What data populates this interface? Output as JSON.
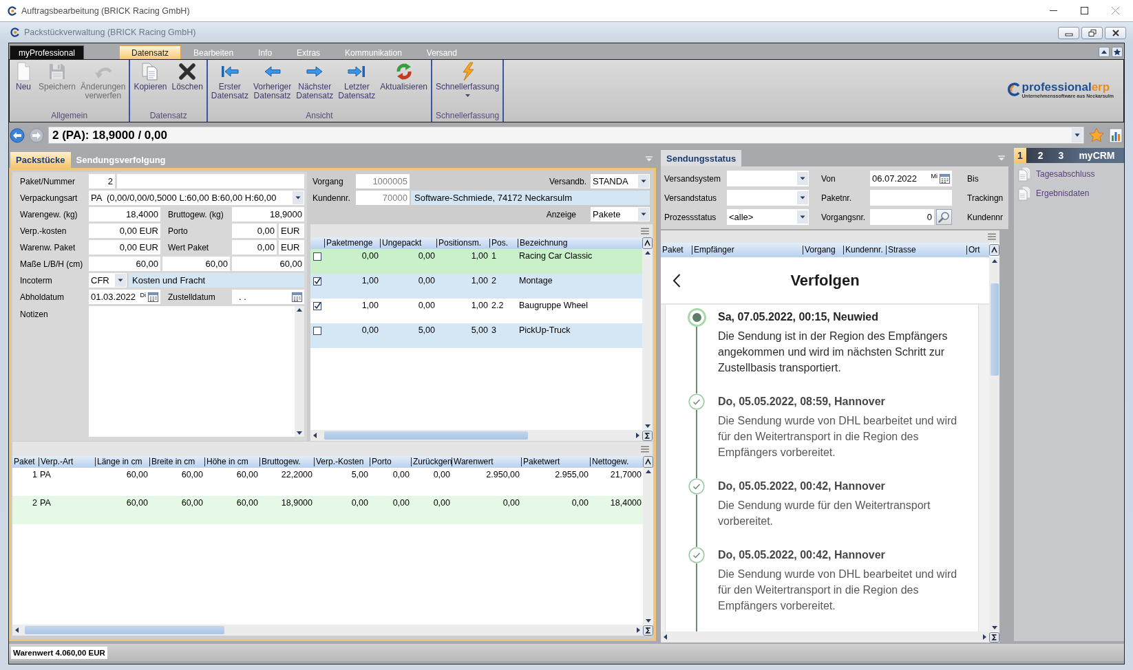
{
  "window": {
    "title": "Auftragsbearbeitung (BRICK Racing GmbH)"
  },
  "child_window": {
    "title": "Packstückverwaltung (BRICK Racing GmbH)"
  },
  "ribbon": {
    "app_tab": "myProfessional",
    "tabs": [
      {
        "label": "Datensatz",
        "selected": true
      },
      {
        "label": "Bearbeiten",
        "selected": false
      },
      {
        "label": "Info",
        "selected": false
      },
      {
        "label": "Extras",
        "selected": false
      },
      {
        "label": "Kommunikation",
        "selected": false
      },
      {
        "label": "Versand",
        "selected": false
      }
    ],
    "groups": [
      {
        "label": "Allgemein",
        "buttons": [
          {
            "label": "Neu",
            "disabled": false,
            "dropdown": false
          },
          {
            "label": "Speichern",
            "disabled": true,
            "dropdown": false
          },
          {
            "label": "Änderungen verwerfen",
            "disabled": true,
            "dropdown": false
          }
        ]
      },
      {
        "label": "Datensatz",
        "buttons": [
          {
            "label": "Kopieren",
            "disabled": false,
            "dropdown": false
          },
          {
            "label": "Löschen",
            "disabled": false,
            "dropdown": false
          }
        ]
      },
      {
        "label": "Ansicht",
        "buttons": [
          {
            "label": "Erster Datensatz",
            "disabled": false,
            "dropdown": false
          },
          {
            "label": "Vorheriger Datensatz",
            "disabled": false,
            "dropdown": false
          },
          {
            "label": "Nächster Datensatz",
            "disabled": false,
            "dropdown": false
          },
          {
            "label": "Letzter Datensatz",
            "disabled": false,
            "dropdown": false
          },
          {
            "label": "Aktualisieren",
            "disabled": false,
            "dropdown": false
          }
        ]
      },
      {
        "label": "Schnellerfassung",
        "buttons": [
          {
            "label": "Schnellerfassung",
            "disabled": false,
            "dropdown": true
          }
        ]
      }
    ]
  },
  "logo": {
    "text": "professional",
    "accent": "erp",
    "tagline": "Unternehmenssoftware aus Neckarsulm"
  },
  "record_bar": {
    "value": "2 (PA): 18,9000 / 0,00",
    "back_disabled": false,
    "forward_disabled": true
  },
  "main_tabs": [
    {
      "label": "Packstücke",
      "selected": true
    },
    {
      "label": "Sendungsverfolgung",
      "selected": false
    }
  ],
  "package_form": {
    "paket_nummer": {
      "label": "Paket/Nummer",
      "value": "2"
    },
    "verpackungsart": {
      "label": "Verpackungsart",
      "value": "PA  (0,00/0,00/0,5000 L:60,00 B:60,00 H:60,00"
    },
    "warengewicht": {
      "label": "Warengew. (kg)",
      "value": "18,4000"
    },
    "bruttogewicht": {
      "label": "Bruttogew. (kg)",
      "value": "18,9000"
    },
    "verp_kosten": {
      "label": "Verp.-kosten",
      "value": "0,00 EUR"
    },
    "porto": {
      "label": "Porto",
      "value": "0,00",
      "unit": "EUR"
    },
    "warenwert_paket": {
      "label": "Warenw. Paket",
      "value": "0,00 EUR"
    },
    "wert_paket": {
      "label": "Wert Paket",
      "value": "0,00",
      "unit": "EUR"
    },
    "masse": {
      "label": "Maße L/B/H (cm)",
      "values": [
        "60,00",
        "60,00",
        "60,00"
      ]
    },
    "incoterm": {
      "label": "Incoterm",
      "value": "CFR",
      "description": "Kosten und Fracht"
    },
    "abholdatum": {
      "label": "Abholdatum",
      "value": "01.03.2022",
      "weekday": "Di"
    },
    "zustelldatum": {
      "label": "Zustelldatum",
      "value": ". ."
    },
    "notizen": {
      "label": "Notizen"
    }
  },
  "order_info": {
    "vorgang": {
      "label": "Vorgang",
      "value": "1000005",
      "readonly": true
    },
    "versandbedingung": {
      "label": "Versandb.",
      "value": "STANDA"
    },
    "kundennr": {
      "label": "Kundennr.",
      "value": "70000",
      "readonly": true,
      "description": "Software-Schmiede, 74172 Neckarsulm"
    },
    "anzeige": {
      "label": "Anzeige",
      "value": "Pakete"
    }
  },
  "positions_table": {
    "columns": [
      "Paketmenge",
      "Ungepackt",
      "Positionsm.",
      "Pos.",
      "Bezeichnung"
    ],
    "rows": [
      {
        "checked": false,
        "color": "#c9f0c9",
        "cells": [
          "0,00",
          "0,00",
          "1,00",
          "1",
          "Racing Car Classic"
        ]
      },
      {
        "checked": true,
        "color": "#d5e7f5",
        "cells": [
          "1,00",
          "0,00",
          "1,00",
          "2",
          "Montage"
        ]
      },
      {
        "checked": true,
        "color": "#ffffff",
        "cells": [
          "1,00",
          "0,00",
          "1,00",
          "2.2",
          "Baugruppe Wheel"
        ]
      },
      {
        "checked": false,
        "color": "#d5e7f5",
        "cells": [
          "0,00",
          "5,00",
          "5,00",
          "3",
          "PickUp-Truck"
        ]
      }
    ]
  },
  "packages_table": {
    "columns": [
      "Paket",
      "Verp.-Art",
      "Länge in cm",
      "Breite in cm",
      "Höhe in cm",
      "Bruttogew.",
      "Verp.-Kosten",
      "Porto",
      "Zurückgen",
      "Warenwert",
      "Paketwert",
      "Nettogew."
    ],
    "rows": [
      {
        "selected": false,
        "cells": [
          "1",
          "PA",
          "60,00",
          "60,00",
          "60,00",
          "22,2000",
          "5,00",
          "0,00",
          "0,00",
          "2.950,00",
          "2.955,00",
          "21,7000"
        ]
      },
      {
        "selected": true,
        "cells": [
          "2",
          "PA",
          "60,00",
          "60,00",
          "60,00",
          "18,9000",
          "0,00",
          "0,00",
          "0,00",
          "0,00",
          "0,00",
          "18,4000"
        ]
      }
    ]
  },
  "status_panel": {
    "tabs": [
      {
        "label": "Sendungsstatus",
        "selected": true
      }
    ],
    "filters": {
      "versandsystem": {
        "label": "Versandsystem"
      },
      "von": {
        "label": "Von",
        "value": "06.07.2022",
        "weekday": "Mi"
      },
      "bis": {
        "label": "Bis"
      },
      "versandstatus": {
        "label": "Versandstatus"
      },
      "paketnr": {
        "label": "Paketnr."
      },
      "trackingnr": {
        "label": "Trackingn"
      },
      "prozessstatus": {
        "label": "Prozessstatus",
        "value": "<alle>"
      },
      "vorgangsnr": {
        "label": "Vorgangsnr.",
        "value": "0"
      },
      "kundennr": {
        "label": "Kundennr"
      }
    },
    "table": {
      "columns": [
        "Paket",
        "Empfänger",
        "Vorgang",
        "Kundennr.",
        "Strasse",
        "Ort"
      ]
    },
    "tracking": {
      "title": "Verfolgen",
      "events": [
        {
          "heading": "Sa, 07.05.2022, 00:15, Neuwied",
          "text": "Die Sendung ist in der Region des Empfängers angekommen und wird im nächsten Schritt zur Zustellbasis transportiert.",
          "current": true
        },
        {
          "heading": "Do, 05.05.2022, 08:59, Hannover",
          "text": "Die Sendung wurde von DHL bearbeitet und wird für den Weitertransport in die Region des Empfängers vorbereitet.",
          "current": false
        },
        {
          "heading": "Do, 05.05.2022, 00:42, Hannover",
          "text": "Die Sendung wurde für den Weitertransport vorbereitet.",
          "current": false
        },
        {
          "heading": "Do, 05.05.2022, 00:42, Hannover",
          "text": "Die Sendung wurde von DHL bearbeitet und wird für den Weitertransport in die Region des Empfängers vorbereitet.",
          "current": false
        }
      ]
    }
  },
  "side_panel": {
    "tabs": [
      {
        "label": "1",
        "selected": true
      },
      {
        "label": "2",
        "selected": false
      },
      {
        "label": "3",
        "selected": false
      },
      {
        "label": "myCRM",
        "selected": false
      }
    ],
    "items": [
      "Tagesabschluss",
      "Ergebnisdaten"
    ]
  },
  "status_bar": {
    "text": "Warenwert 4.060,00 EUR"
  }
}
